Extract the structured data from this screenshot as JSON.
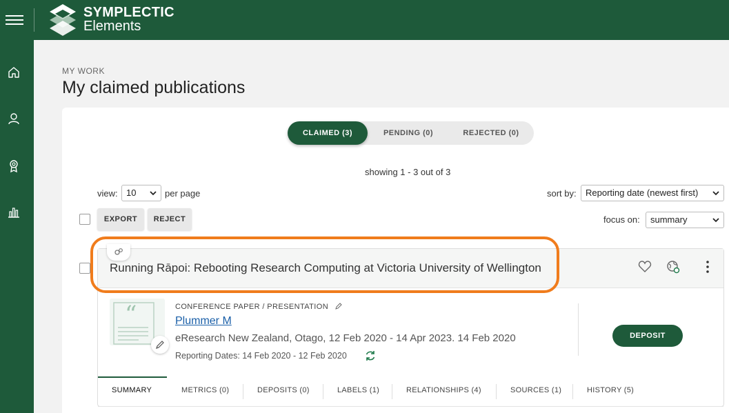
{
  "header": {
    "brand_line1": "SYMPLECTIC",
    "brand_line2": "Elements",
    "brand_color": "#1e5a3a"
  },
  "sidebar": {
    "items": [
      {
        "icon": "home-icon"
      },
      {
        "icon": "user-icon"
      },
      {
        "icon": "award-icon"
      },
      {
        "icon": "bar-chart-icon"
      }
    ]
  },
  "page": {
    "breadcrumb": "MY WORK",
    "title": "My claimed publications"
  },
  "status_tabs": [
    {
      "label": "CLAIMED (3)",
      "active": true
    },
    {
      "label": "PENDING (0)",
      "active": false
    },
    {
      "label": "REJECTED (0)",
      "active": false
    }
  ],
  "results": {
    "showing": "showing 1 - 3 out of 3",
    "view_label": "view:",
    "per_page_value": "10",
    "per_page_suffix": "per page",
    "sort_label": "sort by:",
    "sort_value": "Reporting date (newest first)",
    "focus_label": "focus on:",
    "focus_value": "summary"
  },
  "actions": {
    "export_label": "EXPORT",
    "reject_label": "REJECT"
  },
  "publication": {
    "title": "Running Rāpoi: Rebooting Research Computing at Victoria University of Wellington",
    "type": "CONFERENCE PAPER / PRESENTATION",
    "author": "Plummer M",
    "venue": "eResearch New Zealand, Otago, 12 Feb 2020 - 14 Apr 2023. 14 Feb 2020",
    "reporting_dates": "Reporting Dates: 14 Feb 2020 - 12 Feb 2020",
    "deposit_label": "DEPOSIT",
    "highlight_color": "#f07c1c"
  },
  "publication_tabs": [
    {
      "label": "SUMMARY",
      "active": true
    },
    {
      "label": "METRICS (0)"
    },
    {
      "label": "DEPOSITS (0)"
    },
    {
      "label": "LABELS (1)"
    },
    {
      "label": "RELATIONSHIPS (4)"
    },
    {
      "label": "SOURCES (1)"
    },
    {
      "label": "HISTORY (5)"
    }
  ]
}
